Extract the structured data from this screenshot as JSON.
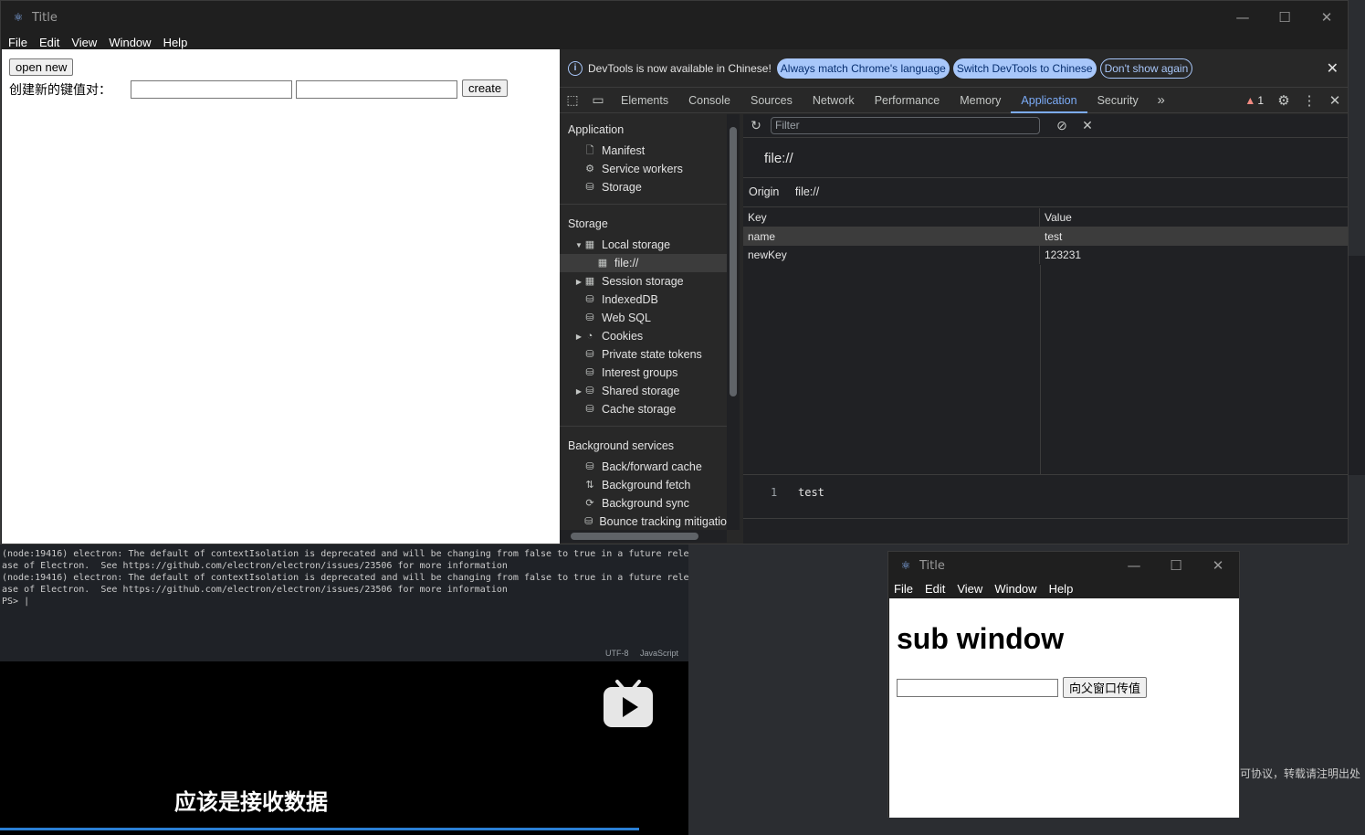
{
  "main_window": {
    "title": "Title",
    "menu": [
      "File",
      "Edit",
      "View",
      "Window",
      "Help"
    ],
    "page": {
      "open_new_label": "open new",
      "kv_label": "创建新的键值对：",
      "create_label": "create"
    }
  },
  "devtools": {
    "infobar": {
      "message": "DevTools is now available in Chinese!",
      "btn_match": "Always match Chrome's language",
      "btn_switch": "Switch DevTools to Chinese",
      "btn_dont_show": "Don't show again"
    },
    "tabs": [
      "Elements",
      "Console",
      "Sources",
      "Network",
      "Performance",
      "Memory",
      "Application",
      "Security"
    ],
    "active_tab": "Application",
    "warning_count": "1",
    "sidebar": {
      "application_title": "Application",
      "application_items": [
        "Manifest",
        "Service workers",
        "Storage"
      ],
      "storage_title": "Storage",
      "storage_items": [
        "Local storage",
        "file://",
        "Session storage",
        "IndexedDB",
        "Web SQL",
        "Cookies",
        "Private state tokens",
        "Interest groups",
        "Shared storage",
        "Cache storage"
      ],
      "background_title": "Background services",
      "background_items": [
        "Back/forward cache",
        "Background fetch",
        "Background sync",
        "Bounce tracking mitigatio"
      ]
    },
    "pane": {
      "filter_placeholder": "Filter",
      "origin_heading": "file://",
      "origin_label": "Origin",
      "origin_value": "file://",
      "col_key": "Key",
      "col_value": "Value",
      "rows": [
        {
          "key": "name",
          "value": "test"
        },
        {
          "key": "newKey",
          "value": "123231"
        }
      ],
      "preview_line": "1",
      "preview_value": "test"
    }
  },
  "terminal": {
    "lines": [
      "(node:19416) electron: The default of contextIsolation is deprecated and will be changing from false to true in a future rele",
      "ase of Electron.  See https://github.com/electron/electron/issues/23506 for more information",
      "(node:19416) electron: The default of contextIsolation is deprecated and will be changing from false to true in a future rele",
      "ase of Electron.  See https://github.com/electron/electron/issues/23506 for more information",
      "PS> |"
    ],
    "encoding": "UTF-8",
    "language": "JavaScript"
  },
  "video": {
    "subtitle": "应该是接收数据"
  },
  "sub_window": {
    "title": "Title",
    "menu": [
      "File",
      "Edit",
      "View",
      "Window",
      "Help"
    ],
    "heading": "sub window",
    "send_label": "向父窗口传值"
  },
  "background_note": "可协议，转载请注明出处",
  "colors": {
    "accent": "#7cacf8",
    "pill": "#a8c7fa",
    "devtools_bg": "#282828"
  }
}
